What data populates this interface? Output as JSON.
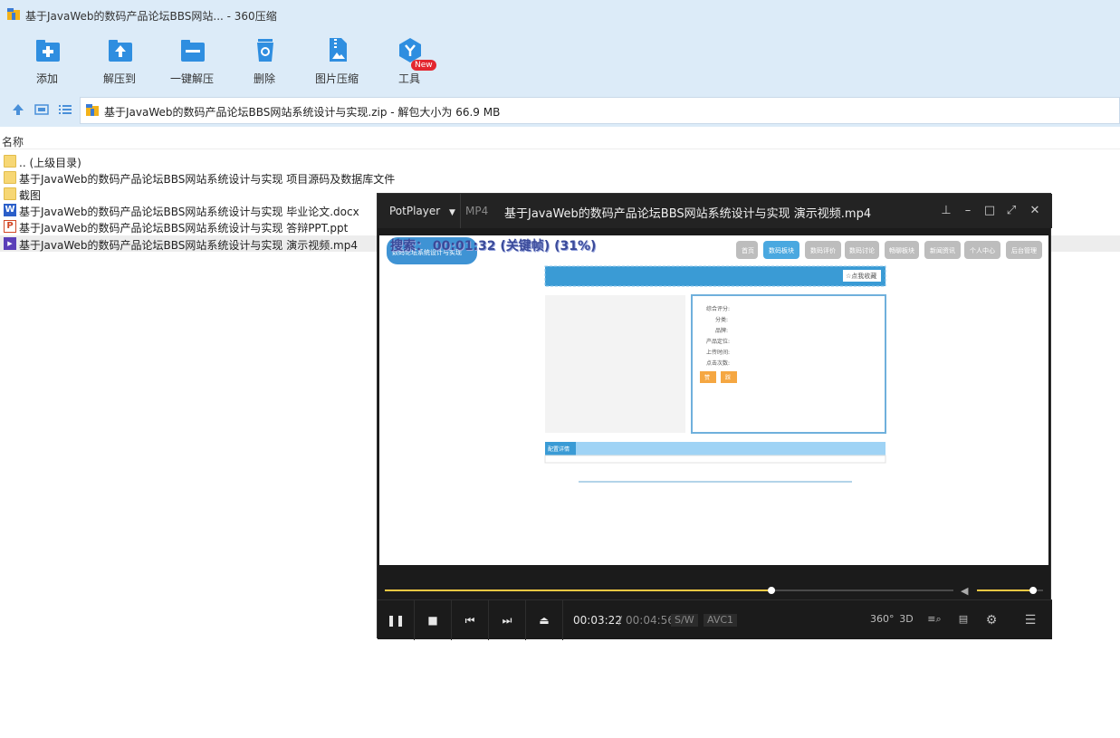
{
  "window": {
    "title": "基于JavaWeb的数码产品论坛BBS网站... - 360压缩"
  },
  "toolbar": {
    "add": "添加",
    "extract_to": "解压到",
    "one_click_extract": "一键解压",
    "delete": "删除",
    "image_compress": "图片压缩",
    "tools": "工具",
    "new_badge": "New"
  },
  "path": {
    "text": "基于JavaWeb的数码产品论坛BBS网站系统设计与实现.zip - 解包大小为 66.9 MB"
  },
  "list": {
    "column_name": "名称",
    "items": [
      {
        "name": ".. (上级目录)",
        "type": "folder"
      },
      {
        "name": "基于JavaWeb的数码产品论坛BBS网站系统设计与实现 项目源码及数据库文件",
        "type": "folder"
      },
      {
        "name": "截图",
        "type": "folder"
      },
      {
        "name": "基于JavaWeb的数码产品论坛BBS网站系统设计与实现 毕业论文.docx",
        "type": "docx"
      },
      {
        "name": "基于JavaWeb的数码产品论坛BBS网站系统设计与实现 答辩PPT.ppt",
        "type": "ppt"
      },
      {
        "name": "基于JavaWeb的数码产品论坛BBS网站系统设计与实现 演示视频.mp4",
        "type": "mp4"
      }
    ]
  },
  "player": {
    "brand": "PotPlayer",
    "format": "MP4",
    "filename": "基于JavaWeb的数码产品论坛BBS网站系统设计与实现 演示视频.mp4",
    "osd": "搜索：  00:01:32 (关键帧) (31%)",
    "current_time": "00:03:22",
    "separator": "/",
    "total_time": "00:04:56",
    "tag_sw": "S/W",
    "tag_codec": "AVC1",
    "label_360": "360°",
    "label_3d": "3D",
    "progress": 0.68,
    "volume": 0.85
  },
  "video_page": {
    "logo_text": "数码论坛系统设计与实现",
    "nav": [
      "首页",
      "数码板块",
      "数码评价",
      "数码讨论",
      "畅聊板块",
      "新闻资讯",
      "个人中心",
      "后台管理"
    ],
    "collect_button": "☆点我收藏",
    "fields": [
      "综合评分:",
      "分类:",
      "品牌:",
      "产品定位:",
      "上传时间:",
      "点击次数:"
    ],
    "btn_a": "赞",
    "btn_b": "踩",
    "detail_tab": "配置详情"
  },
  "colors": {
    "accent": "#2f8ee0",
    "chrome": "#dcebf8",
    "player_bg": "#1b1b1b",
    "seek": "#f5c842"
  }
}
